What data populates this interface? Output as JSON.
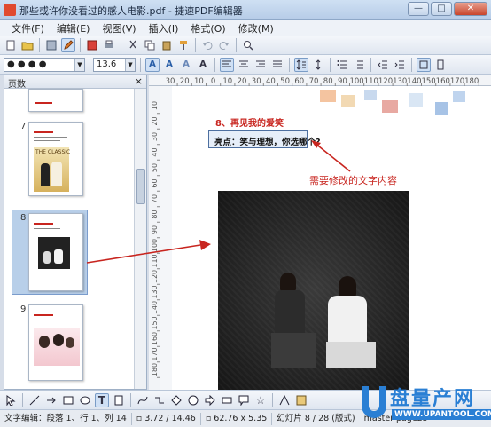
{
  "window": {
    "title": "那些或许你没看过的感人电影.pdf - 捷速PDF编辑器",
    "controls": {
      "minimize": "—",
      "maximize": "□",
      "close": "✕"
    }
  },
  "menubar": [
    {
      "label": "文件(F)"
    },
    {
      "label": "编辑(E)"
    },
    {
      "label": "视图(V)"
    },
    {
      "label": "插入(I)"
    },
    {
      "label": "格式(O)"
    },
    {
      "label": "修改(M)"
    }
  ],
  "format_toolbar": {
    "font_name": "● ● ● ●",
    "font_size": "13.6"
  },
  "pages_panel": {
    "title": "页数",
    "close_glyph": "×",
    "pages": [
      {
        "number": "7",
        "thumb_text": "THE CLASSIC"
      },
      {
        "number": "8"
      },
      {
        "number": "9"
      }
    ]
  },
  "ruler": {
    "horizontal_labels": [
      "30",
      "20",
      "10",
      "0",
      "10",
      "20",
      "30",
      "40",
      "50",
      "60",
      "70",
      "80",
      "90",
      "100",
      "110",
      "120",
      "130",
      "140",
      "150",
      "160",
      "170",
      "180"
    ],
    "vertical_labels": [
      "10",
      "20",
      "30",
      "40",
      "50",
      "60",
      "70",
      "80",
      "90",
      "100",
      "110",
      "120",
      "130",
      "140",
      "150",
      "160",
      "170",
      "180"
    ]
  },
  "document": {
    "heading": "8、再见我的爱笑",
    "selected_text": "亮点：笑与理想，你选哪个?",
    "annotation": "需要修改的文字内容"
  },
  "status": {
    "mode": "文字编辑：段落 1、行 1、列 14",
    "position": "3.72 / 14.46",
    "size": "62.76 x 5.35",
    "slide": "幻灯片 8 / 28 (版式)",
    "master": "master-page25"
  },
  "watermark": {
    "brand": "盘量产网",
    "url": "WWW.UPANTOOL.COM"
  },
  "colors": {
    "accent_red": "#c8251f",
    "selection_blue": "#b8cfe9"
  }
}
